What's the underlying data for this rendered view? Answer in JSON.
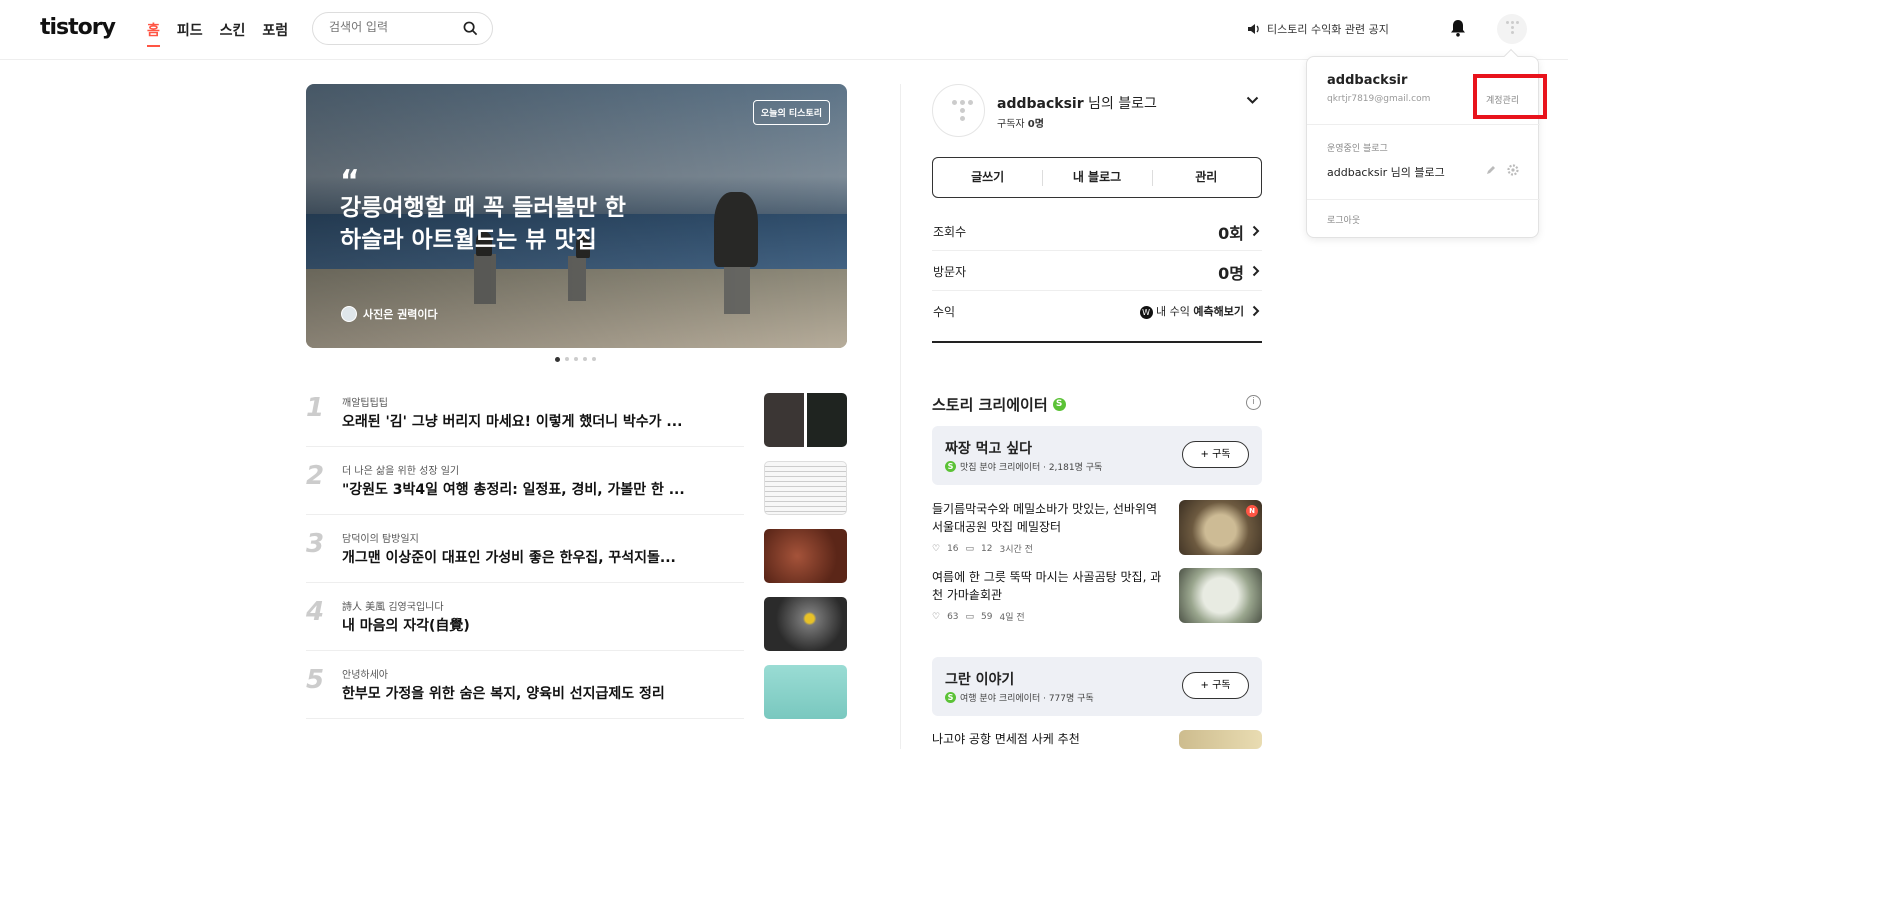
{
  "header": {
    "logo": "tistory",
    "nav": [
      "홈",
      "피드",
      "스킨",
      "포럼"
    ],
    "search_placeholder": "검색어 입력",
    "notice": "티스토리 수익화 관련 공지"
  },
  "hero": {
    "badge": "오늘의 티스토리",
    "quote_mark": "“",
    "title": "강릉여행할 때 꼭 들러볼만 한 하슬라 아트월드는 뷰 맛집",
    "author": "사진은 권력이다",
    "slides": 5,
    "active_slide": 1
  },
  "ranking": [
    {
      "num": "1",
      "category": "깨알팁팁팁",
      "title": "오래된 '김' 그냥 버리지 마세요! 이렇게 했더니 박수가 ...",
      "thumb_color": "#2e2c2a"
    },
    {
      "num": "2",
      "category": "더 나은 삶을 위한 성장 일기",
      "title": "\"강원도 3박4일 여행 총정리: 일정표, 경비, 가볼만 한 ...",
      "thumb_color": "#f4f4f4"
    },
    {
      "num": "3",
      "category": "담덕이의 탐방일지",
      "title": "개그맨 이상준이 대표인 가성비 좋은 한우집, 꾸석지돌...",
      "thumb_color": "#7a3b24"
    },
    {
      "num": "4",
      "category": "詩人 美風 김영국입니다",
      "title": "내 마음의 자각(自覺)",
      "thumb_color": "#3a3a3a"
    },
    {
      "num": "5",
      "category": "안녕하세아",
      "title": "한부모 가정을 위한 숨은 복지, 양육비 선지급제도 정리",
      "thumb_color": "#8fd6cf"
    }
  ],
  "blog": {
    "name": "addbacksir",
    "name_suffix": " 님의 블로그",
    "subscribers_label": "구독자 ",
    "subscribers": "0명",
    "actions": [
      "글쓰기",
      "내 블로그",
      "관리"
    ],
    "stats": [
      {
        "label": "조회수",
        "value": "0회"
      },
      {
        "label": "방문자",
        "value": "0명"
      },
      {
        "label": "수익",
        "value_prefix": "내 수익 ",
        "value": "예측해보기"
      }
    ]
  },
  "creators_section": {
    "title": "스토리 크리에이터",
    "creators": [
      {
        "name": "짜장 먹고 싶다",
        "desc": "맛집 분야 크리에이터 · 2,181명 구독",
        "subscribe": "+ 구독",
        "posts": [
          {
            "title": "들기름막국수와 메밀소바가 맛있는, 선바위역 서울대공원 맛집 메밀장터",
            "likes": "16",
            "comments": "12",
            "time": "3시간 전",
            "new_badge": "N",
            "img_color": "#8c7a5e"
          },
          {
            "title": "여름에 한 그릇 뚝딱 마시는 사골곰탕 맛집, 과천 가마솥회관",
            "likes": "63",
            "comments": "59",
            "time": "4일 전",
            "img_color": "#cfd3c6"
          }
        ]
      },
      {
        "name": "그란 이야기",
        "desc": "여행 분야 크리에이터 · 777명 구독",
        "subscribe": "+ 구독",
        "posts": [
          {
            "title": "나고야 공항 면세점 사케 추천",
            "img_color": "#d8c79a"
          }
        ]
      }
    ]
  },
  "dropdown": {
    "username": "addbacksir",
    "email": "qkrtjr7819@gmail.com",
    "account_manage": "계정관리",
    "running_blogs_label": "운영중인 블로그",
    "blog_name": "addbacksir 님의 블로그",
    "logout": "로그아웃"
  },
  "colors": {
    "accent": "#ff5544",
    "highlight_box": "#e8131c",
    "creator_badge": "#5bc236"
  }
}
